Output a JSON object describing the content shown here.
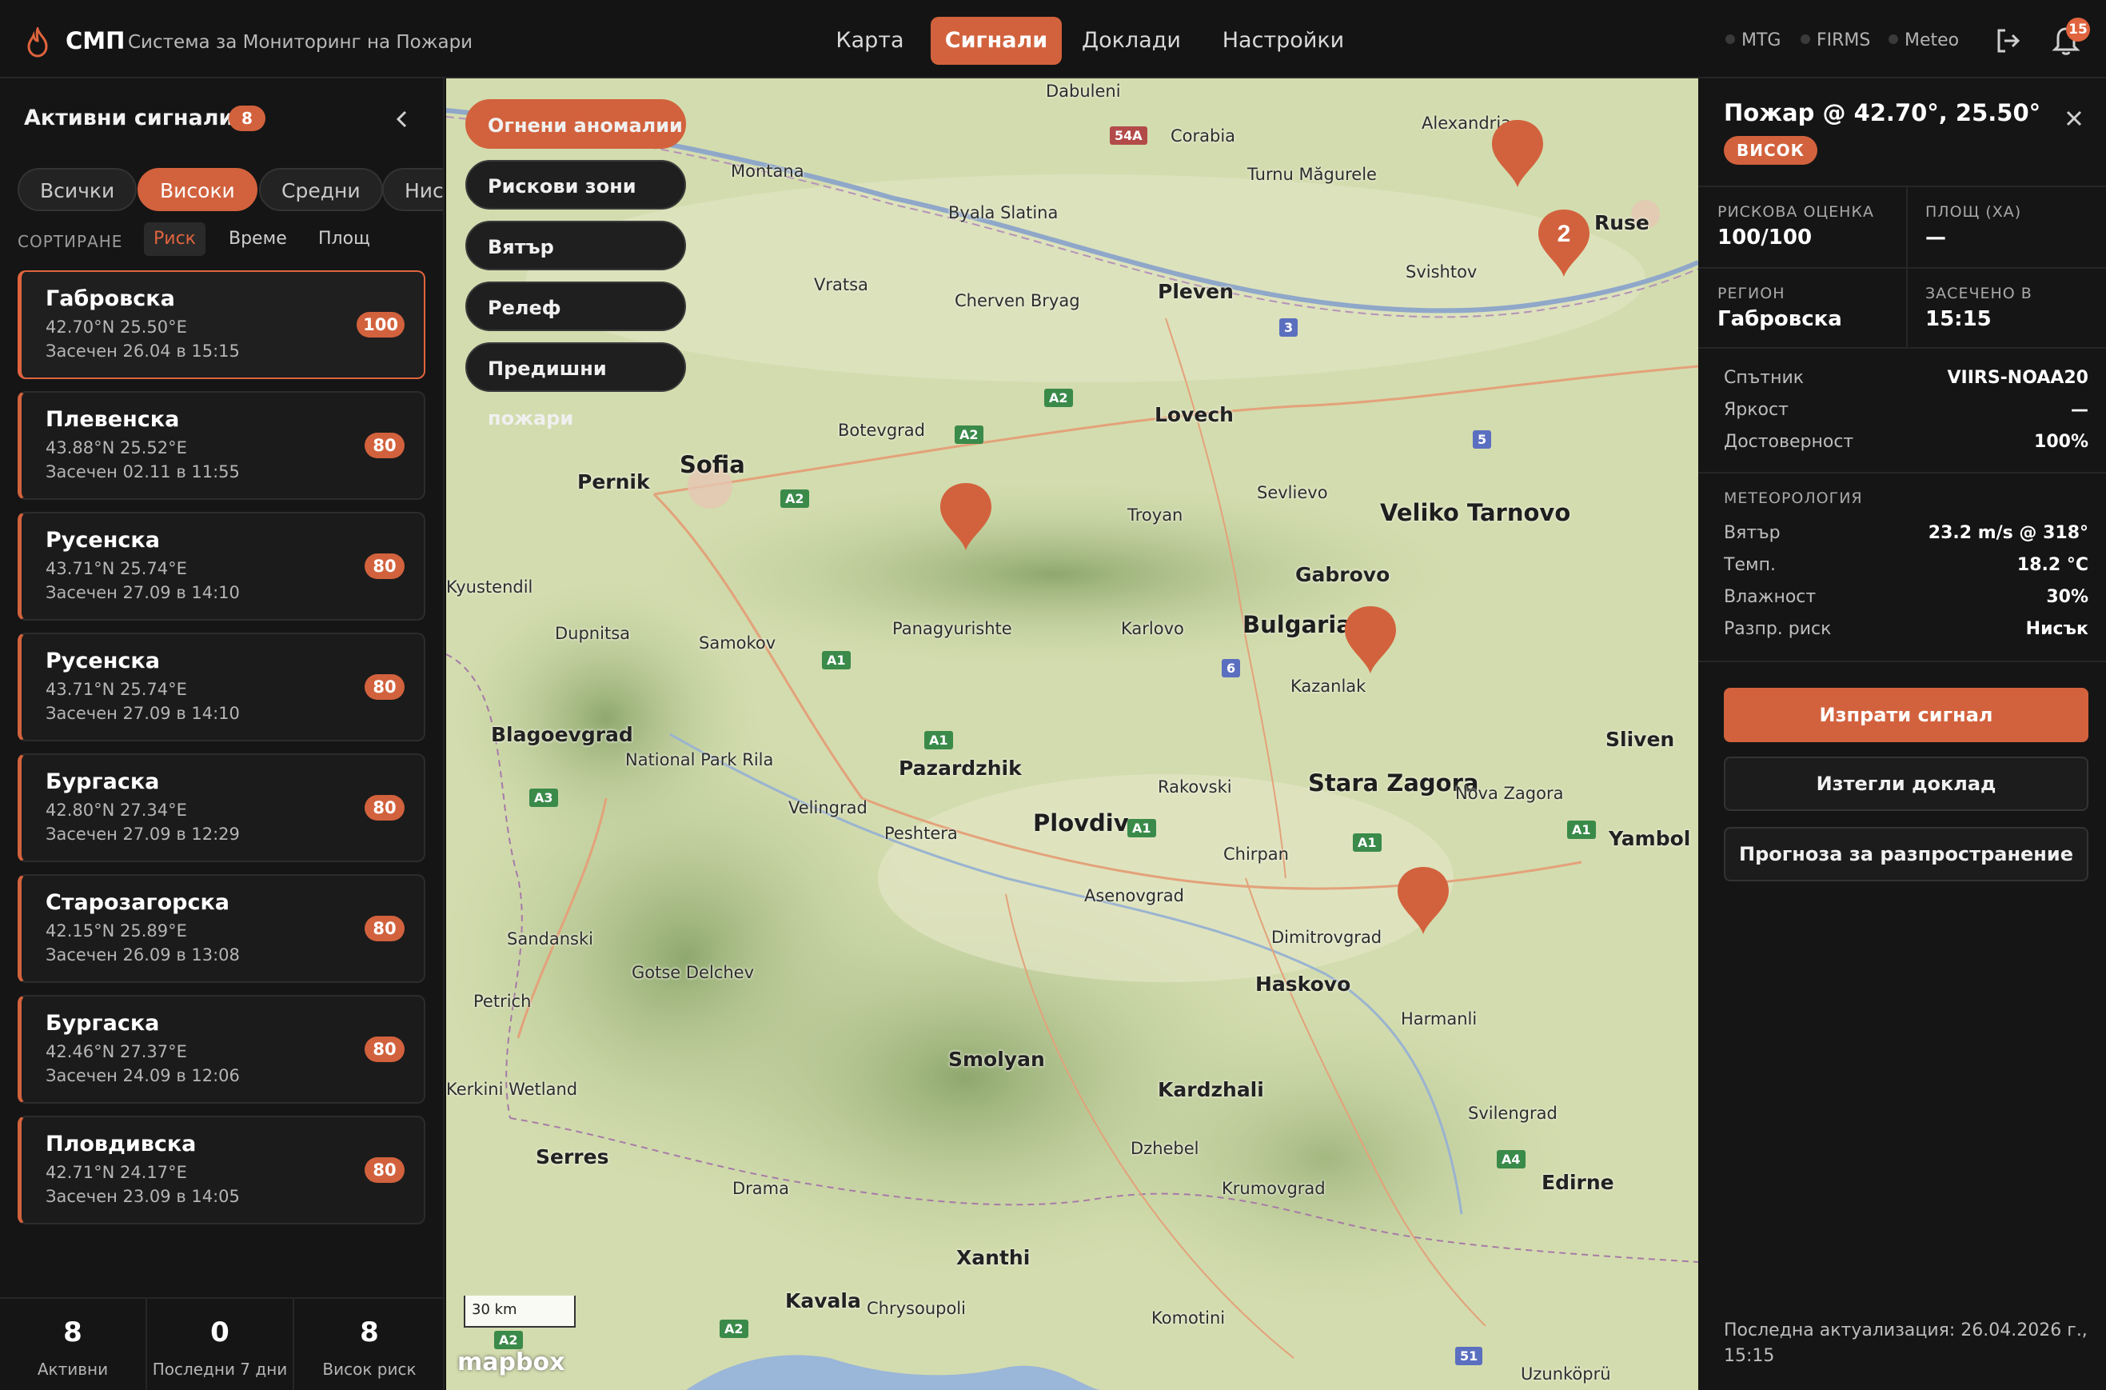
{
  "header": {
    "brand": "СМП",
    "subtitle": "Система за Мониторинг на Пожари",
    "nav": [
      "Карта",
      "Сигнали",
      "Доклади",
      "Настройки"
    ],
    "active_nav": "Сигнали",
    "sources": [
      "MTG",
      "FIRMS",
      "Meteo"
    ],
    "notifications": "15"
  },
  "sidebar": {
    "title": "Активни сигнали",
    "count": "8",
    "filters": [
      "Всички",
      "Високи",
      "Средни",
      "Ниск"
    ],
    "active_filter": "Високи",
    "sort_label": "СОРТИРАНЕ",
    "sort_options": [
      "Риск",
      "Време",
      "Площ"
    ],
    "active_sort": "Риск",
    "alerts": [
      {
        "name": "Габровска",
        "coords": "42.70°N 25.50°E",
        "time": "Засечен 26.04 в 15:15",
        "score": "100"
      },
      {
        "name": "Плевенска",
        "coords": "43.88°N 25.52°E",
        "time": "Засечен 02.11 в 11:55",
        "score": "80"
      },
      {
        "name": "Русенска",
        "coords": "43.71°N 25.74°E",
        "time": "Засечен 27.09 в 14:10",
        "score": "80"
      },
      {
        "name": "Русенска",
        "coords": "43.71°N 25.74°E",
        "time": "Засечен 27.09 в 14:10",
        "score": "80"
      },
      {
        "name": "Бургаска",
        "coords": "42.80°N 27.34°E",
        "time": "Засечен 27.09 в 12:29",
        "score": "80"
      },
      {
        "name": "Старозагорска",
        "coords": "42.15°N 25.89°E",
        "time": "Засечен 26.09 в 13:08",
        "score": "80"
      },
      {
        "name": "Бургаска",
        "coords": "42.46°N 27.37°E",
        "time": "Засечен 24.09 в 12:06",
        "score": "80"
      },
      {
        "name": "Пловдивска",
        "coords": "42.71°N 24.17°E",
        "time": "Засечен 23.09 в 14:05",
        "score": "80"
      }
    ],
    "stats": [
      {
        "value": "8",
        "label": "Активни"
      },
      {
        "value": "0",
        "label": "Последни 7 дни"
      },
      {
        "value": "8",
        "label": "Висок риск"
      }
    ]
  },
  "map": {
    "layers": [
      "Огнени аномалии",
      "Рискови зони",
      "Вятър",
      "Релеф",
      "Предишни пожари"
    ],
    "active_layer": "Огнени аномалии",
    "cluster_count": "2",
    "scale": "30 km",
    "attribution": "mapbox",
    "places": [
      "Dabuleni",
      "Corabia",
      "Alexandria",
      "Montana",
      "Turnu Măgurele",
      "Byala Slatina",
      "Ruse",
      "Svishtov",
      "Vratsa",
      "Cherven Bryag",
      "Pleven",
      "Botevgrad",
      "Lovech",
      "Sofia",
      "Pernik",
      "Troyan",
      "Sevlievo",
      "Veliko Tarnovo",
      "Kyustendil",
      "Dupnitsa",
      "Samokov",
      "Panagyurishte",
      "Karlovo",
      "Gabrovo",
      "Bulgaria",
      "Kazanlak",
      "Blagoevgrad",
      "National Park Rila",
      "Pazardzhik",
      "Rakovski",
      "Stara Zagora",
      "Nova Zagora",
      "Sliven",
      "Velingrad",
      "Peshtera",
      "Plovdiv",
      "Chirpan",
      "Yambol",
      "Asenovgrad",
      "Sandanski",
      "Dimitrovgrad",
      "Gotse Delchev",
      "Haskovo",
      "Petrich",
      "Harmanli",
      "Kerkini Wetland",
      "Smolyan",
      "Kardzhali",
      "Svilengrad",
      "Serres",
      "Dzhebel",
      "Drama",
      "Krumovgrad",
      "Edirne",
      "Xanthi",
      "Kavala",
      "Chrysoupoli",
      "Komotini",
      "Uzunköprü"
    ],
    "roads": [
      "54A",
      "3",
      "A2",
      "A2",
      "A2",
      "5",
      "A1",
      "6",
      "A1",
      "A3",
      "A1",
      "A1",
      "A1",
      "A4",
      "A2",
      "51",
      "A2"
    ]
  },
  "panel": {
    "title": "Пожар @ 42.70°, 25.50°",
    "severity": "ВИСОК",
    "risk_label": "РИСКОВА ОЦЕНКА",
    "risk_value": "100/100",
    "area_label": "ПЛОЩ (ХА)",
    "area_value": "—",
    "region_label": "РЕГИОН",
    "region_value": "Габровска",
    "detected_label": "ЗАСЕЧЕНО В",
    "detected_value": "15:15",
    "details": [
      {
        "k": "Спътник",
        "v": "VIIRS-NOAA20"
      },
      {
        "k": "Яркост",
        "v": "—"
      },
      {
        "k": "Достоверност",
        "v": "100%"
      }
    ],
    "meteo_title": "МЕТЕОРОЛОГИЯ",
    "meteo": [
      {
        "k": "Вятър",
        "v": "23.2 m/s @ 318°"
      },
      {
        "k": "Темп.",
        "v": "18.2 °C"
      },
      {
        "k": "Влажност",
        "v": "30%"
      },
      {
        "k": "Разпр. риск",
        "v": "Нисък"
      }
    ],
    "actions": [
      "Изпрати сигнал",
      "Изтегли доклад",
      "Прогноза за разпространение"
    ],
    "last_update": "Последна актуализация: 26.04.2026 г., 15:15"
  },
  "colors": {
    "accent": "#d2623d",
    "background": "#121212",
    "map_land": "#c9d6a6"
  }
}
